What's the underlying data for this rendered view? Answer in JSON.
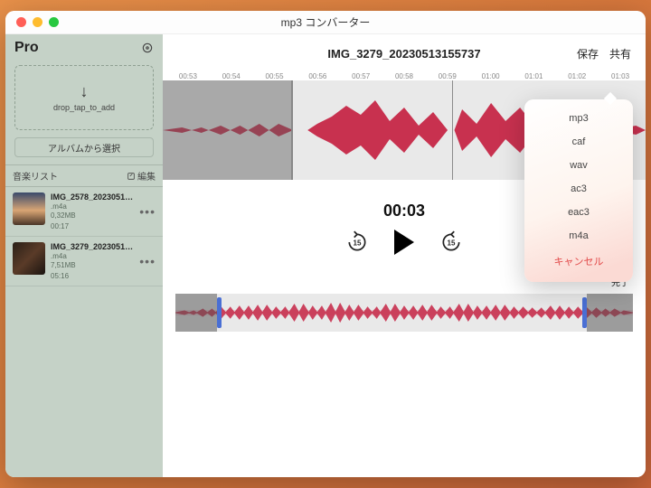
{
  "window": {
    "title": "mp3 コンバーター"
  },
  "sidebar": {
    "pro_label": "Pro",
    "drop_text": "drop_tap_to_add",
    "album_button": "アルバムから選択",
    "list_header": "音楽リスト",
    "edit_label": "編集",
    "items": [
      {
        "name": "IMG_2578_20230513155...",
        "ext": ".m4a",
        "size": "0,32MB",
        "duration": "00:17"
      },
      {
        "name": "IMG_3279_20230513155...",
        "ext": ".m4a",
        "size": "7,51MB",
        "duration": "05:16"
      }
    ]
  },
  "main": {
    "file_title": "IMG_3279_20230513155737",
    "save_label": "保存",
    "share_label": "共有",
    "ruler_ticks": [
      "00:53",
      "00:54",
      "00:55",
      "00:56",
      "00:57",
      "00:58",
      "00:59",
      "01:00",
      "01:01",
      "01:02",
      "01:03"
    ],
    "time_display": "00:03",
    "skip_amount": "15",
    "done_label": "完了"
  },
  "format_menu": {
    "options": [
      "mp3",
      "caf",
      "wav",
      "ac3",
      "eac3",
      "m4a"
    ],
    "cancel": "キャンセル"
  }
}
